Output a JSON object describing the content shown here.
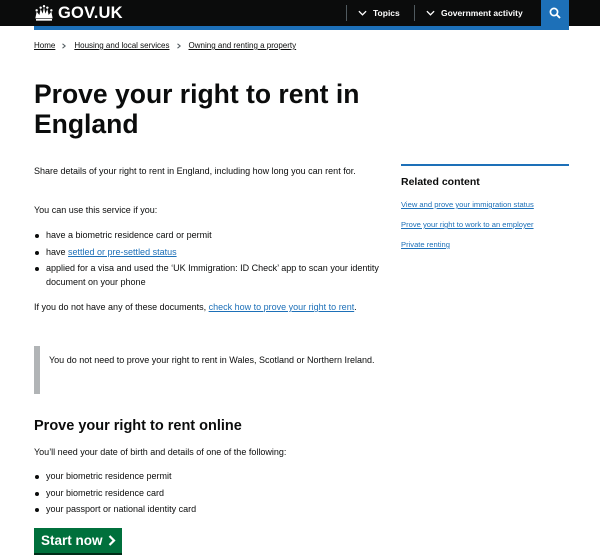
{
  "header": {
    "logo_text": "GOV.UK",
    "nav": [
      {
        "label": "Topics"
      },
      {
        "label": "Government activity"
      }
    ],
    "search_icon": "search-icon"
  },
  "breadcrumbs": [
    {
      "label": "Home"
    },
    {
      "label": "Housing and local services"
    },
    {
      "label": "Owning and renting a property"
    }
  ],
  "page": {
    "title": "Prove your right to rent in England",
    "intro": "Share details of your right to rent in England, including how long you can rent for.",
    "use_heading": "You can use this service if you:",
    "use_items": {
      "item1": "have a biometric residence card or permit",
      "item2_prefix": "have ",
      "item2_link": "settled or pre-settled status",
      "item3": "applied for a visa and used the ‘UK Immigration: ID Check’ app to scan your identity document on your phone"
    },
    "no_docs_prefix": "If you do not have any of these documents, ",
    "no_docs_link": "check how to prove your right to rent",
    "no_docs_suffix": ".",
    "inset_text": "You do not need to prove your right to rent in Wales, Scotland or Northern Ireland.",
    "online_heading": "Prove your right to rent online",
    "online_intro": "You’ll need your date of birth and details of one of the following:",
    "online_items": [
      "your biometric residence permit",
      "your biometric residence card",
      "your passport or national identity card"
    ],
    "start_button": "Start now"
  },
  "related": {
    "title": "Related content",
    "links": [
      "View and prove your immigration status",
      "Prove your right to work to an employer",
      "Private renting"
    ]
  },
  "colors": {
    "header": "#0b0c0c",
    "brand_blue": "#1d70b8",
    "link": "#1d70b8",
    "button_green": "#00703c",
    "inset_border": "#b1b4b6"
  }
}
